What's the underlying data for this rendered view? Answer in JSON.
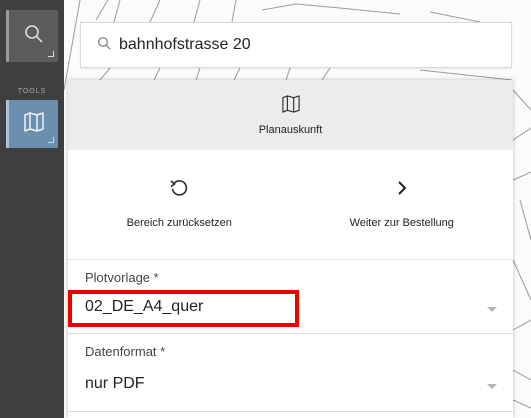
{
  "toolbar": {
    "search_icon": "search-icon",
    "tools_label": "TOOLS",
    "map_icon": "map-icon"
  },
  "search": {
    "icon": "search-icon",
    "value": "bahnhofstrasse 20"
  },
  "panel": {
    "header_icon": "map-icon",
    "header_label": "Planauskunft",
    "actions": [
      {
        "icon": "undo-icon",
        "label": "Bereich zurücksetzen"
      },
      {
        "icon": "chevron-right-icon",
        "label": "Weiter zur Bestellung"
      }
    ],
    "fields": [
      {
        "label": "Plotvorlage *",
        "value": "02_DE_A4_quer"
      },
      {
        "label": "Datenformat *",
        "value": "nur PDF"
      }
    ]
  },
  "colors": {
    "toolbar": "#3f3f3f",
    "toolbar_active": "#6b8fae",
    "highlight": "#ec0000"
  }
}
